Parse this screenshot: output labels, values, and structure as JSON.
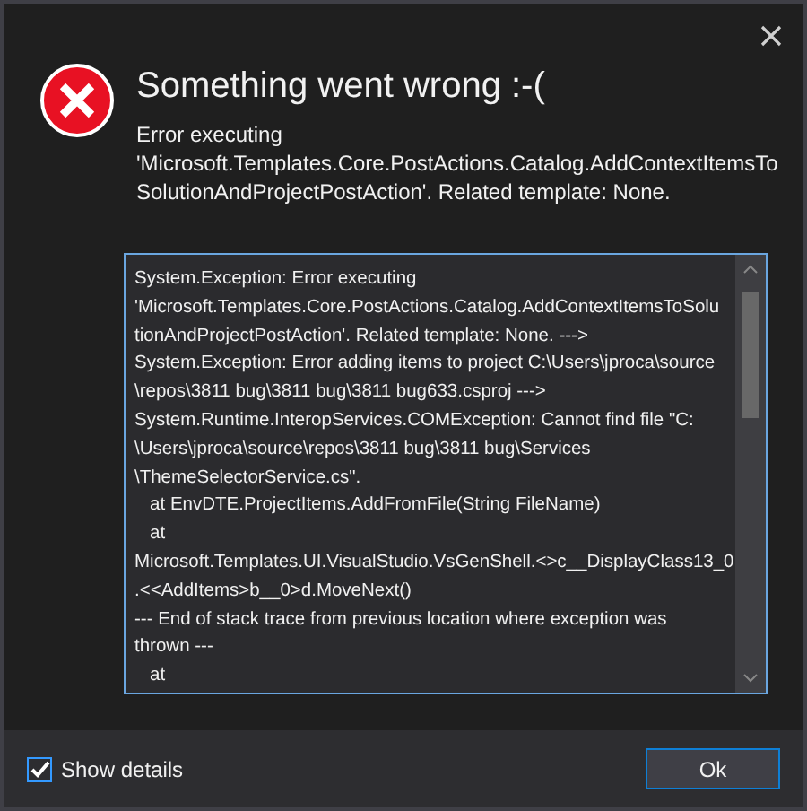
{
  "dialog": {
    "title": "Something went wrong :-(",
    "message": [
      "Error executing",
      "'Microsoft.Templates.Core.PostActions.Catalog.AddContextItemsTo",
      "SolutionAndProjectPostAction'. Related template: None."
    ]
  },
  "details": {
    "lines": [
      "System.Exception: Error executing",
      "'Microsoft.Templates.Core.PostActions.Catalog.AddContextItemsToSolu",
      "tionAndProjectPostAction'. Related template: None. --->",
      "System.Exception: Error adding items to project C:\\Users\\jproca\\source",
      "\\repos\\3811 bug\\3811 bug\\3811 bug633.csproj --->",
      "System.Runtime.InteropServices.COMException: Cannot find file \"C:",
      "\\Users\\jproca\\source\\repos\\3811 bug\\3811 bug\\Services",
      "\\ThemeSelectorService.cs\".",
      "   at EnvDTE.ProjectItems.AddFromFile(String FileName)",
      "   at",
      "Microsoft.Templates.UI.VisualStudio.VsGenShell.<>c__DisplayClass13_0",
      ".<<AddItems>b__0>d.MoveNext()",
      "--- End of stack trace from previous location where exception was",
      "thrown ---",
      "   at"
    ]
  },
  "show_details": {
    "label": "Show details",
    "checked": true
  },
  "buttons": [
    {
      "label": "Ok"
    }
  ]
}
